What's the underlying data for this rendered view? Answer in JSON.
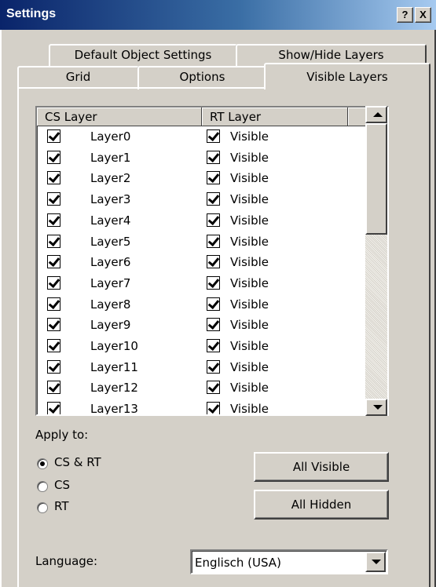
{
  "window": {
    "title": "Settings",
    "help_label": "?",
    "close_label": "X"
  },
  "tabs": {
    "back_row": [
      "Default Object Settings",
      "Show/Hide Layers"
    ],
    "front_row": [
      "Grid",
      "Options",
      "Visible Layers"
    ],
    "active": "Visible Layers"
  },
  "list": {
    "headers": {
      "cs": "CS Layer",
      "rt": "RT Layer"
    },
    "rows": [
      {
        "cs_checked": true,
        "name": "Layer0",
        "rt_checked": true,
        "rt_label": "Visible"
      },
      {
        "cs_checked": true,
        "name": "Layer1",
        "rt_checked": true,
        "rt_label": "Visible"
      },
      {
        "cs_checked": true,
        "name": "Layer2",
        "rt_checked": true,
        "rt_label": "Visible"
      },
      {
        "cs_checked": true,
        "name": "Layer3",
        "rt_checked": true,
        "rt_label": "Visible"
      },
      {
        "cs_checked": true,
        "name": "Layer4",
        "rt_checked": true,
        "rt_label": "Visible"
      },
      {
        "cs_checked": true,
        "name": "Layer5",
        "rt_checked": true,
        "rt_label": "Visible"
      },
      {
        "cs_checked": true,
        "name": "Layer6",
        "rt_checked": true,
        "rt_label": "Visible"
      },
      {
        "cs_checked": true,
        "name": "Layer7",
        "rt_checked": true,
        "rt_label": "Visible"
      },
      {
        "cs_checked": true,
        "name": "Layer8",
        "rt_checked": true,
        "rt_label": "Visible"
      },
      {
        "cs_checked": true,
        "name": "Layer9",
        "rt_checked": true,
        "rt_label": "Visible"
      },
      {
        "cs_checked": true,
        "name": "Layer10",
        "rt_checked": true,
        "rt_label": "Visible"
      },
      {
        "cs_checked": true,
        "name": "Layer11",
        "rt_checked": true,
        "rt_label": "Visible"
      },
      {
        "cs_checked": true,
        "name": "Layer12",
        "rt_checked": true,
        "rt_label": "Visible"
      },
      {
        "cs_checked": true,
        "name": "Layer13",
        "rt_checked": true,
        "rt_label": "Visible"
      }
    ]
  },
  "apply_to": {
    "label": "Apply to:",
    "options": [
      "CS & RT",
      "CS",
      "RT"
    ],
    "selected": "CS & RT"
  },
  "buttons": {
    "all_visible": "All Visible",
    "all_hidden": "All Hidden"
  },
  "language": {
    "label": "Language:",
    "value": "Englisch (USA)"
  },
  "colors": {
    "titlebar": "#0a246a",
    "face": "#d4d0c8"
  }
}
